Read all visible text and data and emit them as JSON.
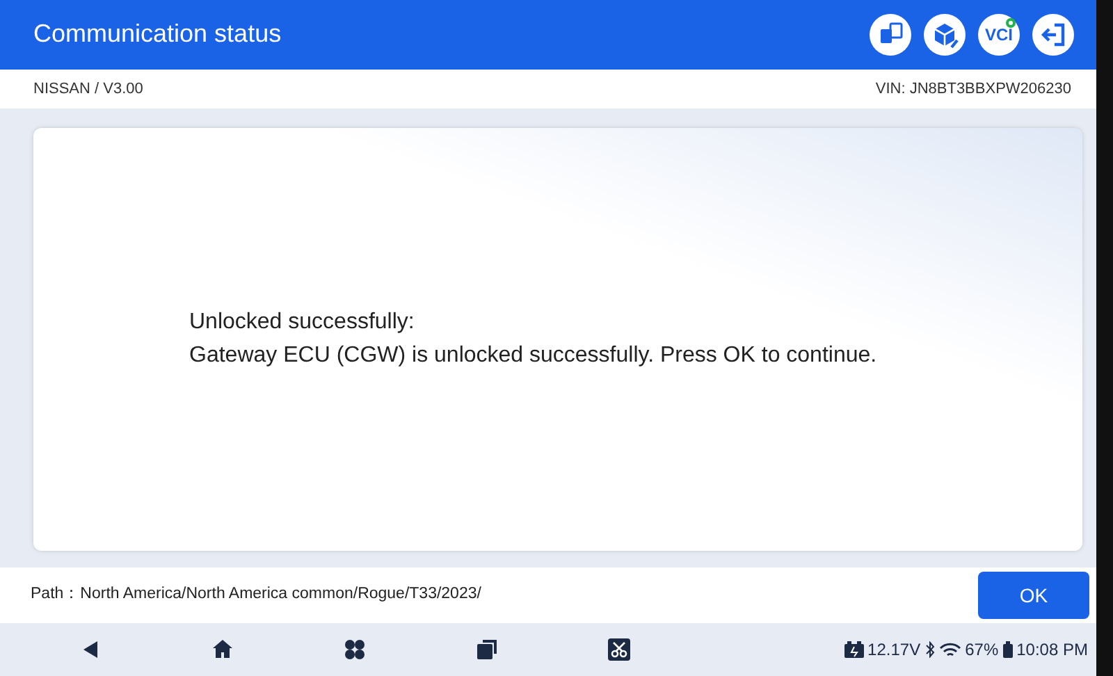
{
  "header": {
    "title": "Communication status",
    "vci_label": "VCI",
    "vci_connected": true
  },
  "info_bar": {
    "left": "NISSAN / V3.00",
    "right": "VIN: JN8BT3BBXPW206230"
  },
  "message": {
    "title": "Unlocked successfully:",
    "body": "Gateway ECU (CGW) is unlocked successfully. Press OK to continue."
  },
  "path": {
    "label": "Path：",
    "value": "North America/North America common/Rogue/T33/2023/"
  },
  "buttons": [
    "OK"
  ],
  "status": {
    "voltage": "12.17V",
    "battery": "67%",
    "time": "10:08 PM"
  }
}
